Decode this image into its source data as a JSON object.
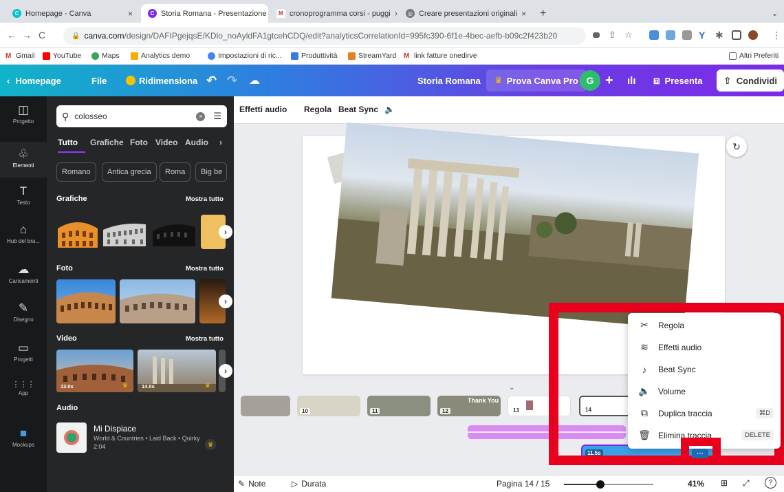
{
  "browser": {
    "tabs": [
      {
        "title": "Homepage - Canva",
        "color": "#00c4cc",
        "active": false
      },
      {
        "title": "Storia Romana - Presentazione",
        "color": "#7d2ae8",
        "active": true
      },
      {
        "title": "cronoprogramma corsi - puggi",
        "color": "#d93025",
        "active": false
      },
      {
        "title": "Creare presentazioni originali",
        "color": "#555555",
        "active": false
      }
    ],
    "url_domain": "canva.com",
    "url_rest": "/design/DAFIPgejqsE/KDlo_noAyldFA1gtcehCDQ/edit?analyticsCorrelationId=995fc390-6f1e-4bec-aefb-b09c2f423b20",
    "bookmarks": [
      "Gmail",
      "YouTube",
      "Maps",
      "Analytics demo",
      "Impostazioni di ric...",
      "Produttività",
      "StreamYard",
      "link fatture onedirve"
    ],
    "bookmarks_other": "Altri Preferiti"
  },
  "topbar": {
    "home": "Homepage",
    "file": "File",
    "resize": "Ridimensiona",
    "title": "Storia Romana",
    "pro": "Prova Canva Pro",
    "avatar": "G",
    "present": "Presenta",
    "share": "Condividi"
  },
  "rail": [
    {
      "icon": "◫",
      "label": "Progetto"
    },
    {
      "icon": "♧",
      "label": "Elementi"
    },
    {
      "icon": "T",
      "label": "Testo"
    },
    {
      "icon": "⌂",
      "label": "Hub del bra..."
    },
    {
      "icon": "☁",
      "label": "Caricamenti"
    },
    {
      "icon": "✎",
      "label": "Disegno"
    },
    {
      "icon": "▭",
      "label": "Progetti"
    },
    {
      "icon": "⋮⋮⋮",
      "label": "App"
    },
    {
      "icon": "■",
      "label": "Mockups"
    }
  ],
  "panel": {
    "search_value": "colosseo",
    "filters": [
      "Tutto",
      "Grafiche",
      "Foto",
      "Video",
      "Audio"
    ],
    "chips": [
      "Romano",
      "Antica grecia",
      "Roma",
      "Big be"
    ],
    "graphics_title": "Grafiche",
    "photos_title": "Foto",
    "videos_title": "Video",
    "audio_title": "Audio",
    "show_all": "Mostra tutto",
    "video_durations": [
      "13.0s",
      "14.0s"
    ],
    "audio_track": {
      "title": "Mi Dispiace",
      "meta": "World & Countries • Laid Back • Quirky",
      "duration": "2:04"
    }
  },
  "editor_toolbar": {
    "audio_effects": "Effetti audio",
    "adjust": "Regola",
    "beat_sync": "Beat Sync"
  },
  "pages_strip": [
    "10",
    "11",
    "12",
    "13",
    "14"
  ],
  "strip_text": "Thank You",
  "video_clip_duration": "11.5s",
  "context_menu": [
    {
      "icon": "✂",
      "label": "Regola",
      "shortcut": ""
    },
    {
      "icon": "≋",
      "label": "Effetti audio",
      "shortcut": ""
    },
    {
      "icon": "♪",
      "label": "Beat Sync",
      "shortcut": ""
    },
    {
      "icon": "🔈",
      "label": "Volume",
      "shortcut": ""
    },
    {
      "icon": "⧉",
      "label": "Duplica traccia",
      "shortcut": "⌘D"
    },
    {
      "icon": "🗑",
      "label": "Elimina traccia",
      "shortcut": "DELETE"
    }
  ],
  "more_button": "···",
  "bottom": {
    "notes": "Note",
    "duration": "Durata",
    "page": "Pagina 14 / 15",
    "zoom": "41%",
    "zoom_level": 0.41
  }
}
